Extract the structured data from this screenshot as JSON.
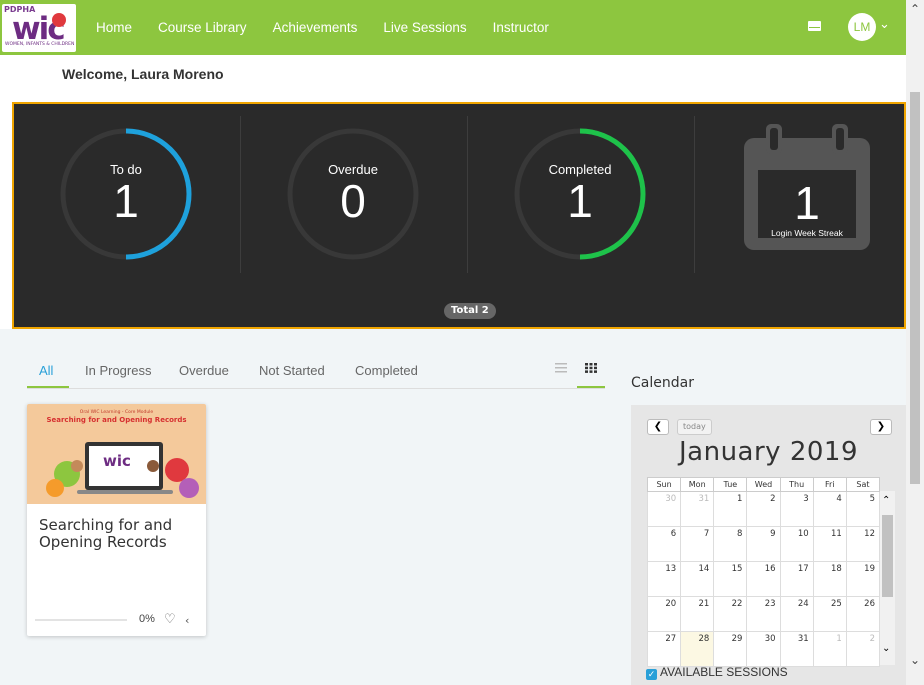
{
  "nav": {
    "logo_badge": "PDPHA",
    "logo_text": "wic",
    "logo_tagline": "WOMEN, INFANTS & CHILDREN",
    "items": [
      "Home",
      "Course Library",
      "Achievements",
      "Live Sessions",
      "Instructor"
    ],
    "user_initials": "LM",
    "accent_color": "#8dc63f"
  },
  "welcome": "Welcome, Laura Moreno",
  "stats": {
    "todo": {
      "label": "To do",
      "value": "1"
    },
    "overdue": {
      "label": "Overdue",
      "value": "0"
    },
    "completed": {
      "label": "Completed",
      "value": "1"
    },
    "streak": {
      "value": "1",
      "label": "Login Week Streak"
    },
    "total": "Total 2",
    "colors": {
      "todo": "#1ea1dc",
      "completed": "#1ec24a",
      "border": "#f0a500"
    }
  },
  "tabs": [
    "All",
    "In Progress",
    "Overdue",
    "Not Started",
    "Completed"
  ],
  "course": {
    "image_line1": "Oral WIC Learning - Core Module",
    "image_line2": "Searching for and Opening Records",
    "image_logo": "wic",
    "title": "Searching for and Opening Records",
    "progress": "0%"
  },
  "calendar": {
    "title": "Calendar",
    "today_label": "today",
    "month": "January 2019",
    "weekdays": [
      "Sun",
      "Mon",
      "Tue",
      "Wed",
      "Thu",
      "Fri",
      "Sat"
    ],
    "weeks": [
      [
        "30",
        "31",
        "1",
        "2",
        "3",
        "4",
        "5"
      ],
      [
        "6",
        "7",
        "8",
        "9",
        "10",
        "11",
        "12"
      ],
      [
        "13",
        "14",
        "15",
        "16",
        "17",
        "18",
        "19"
      ],
      [
        "20",
        "21",
        "22",
        "23",
        "24",
        "25",
        "26"
      ],
      [
        "27",
        "28",
        "29",
        "30",
        "31",
        "1",
        "2"
      ]
    ],
    "available_label": "AVAILABLE SESSIONS"
  }
}
